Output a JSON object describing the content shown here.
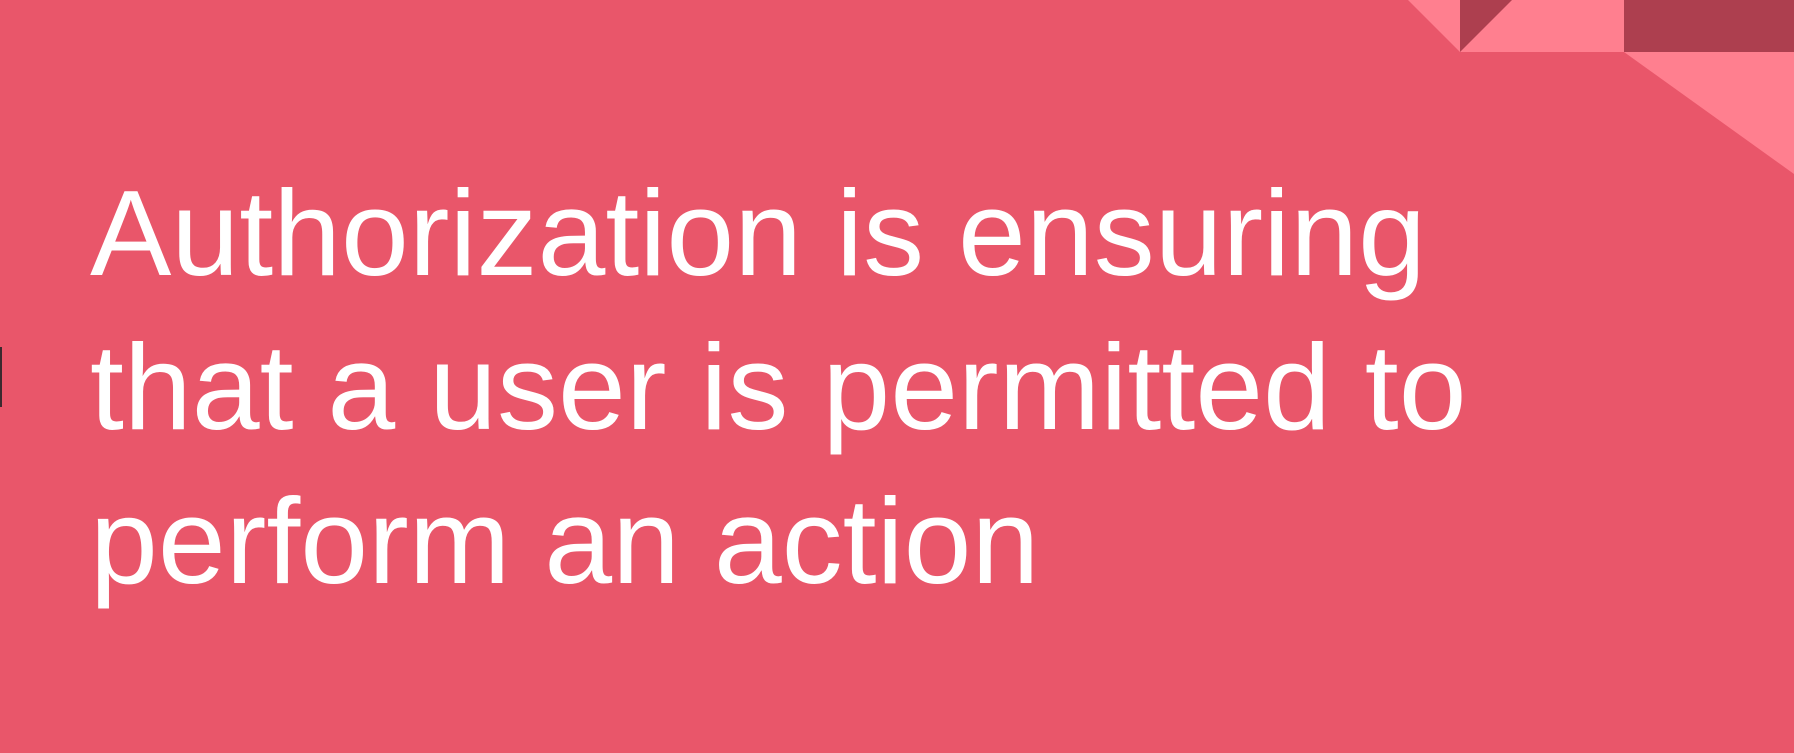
{
  "slide": {
    "lines": [
      "Authorization is ensuring",
      "that a user is permitted to",
      "perform an action"
    ]
  },
  "colors": {
    "background": "#e9566a",
    "text": "#ffffff",
    "accent_light": "#ff7f8f",
    "accent_dark": "#ad3f4f"
  }
}
